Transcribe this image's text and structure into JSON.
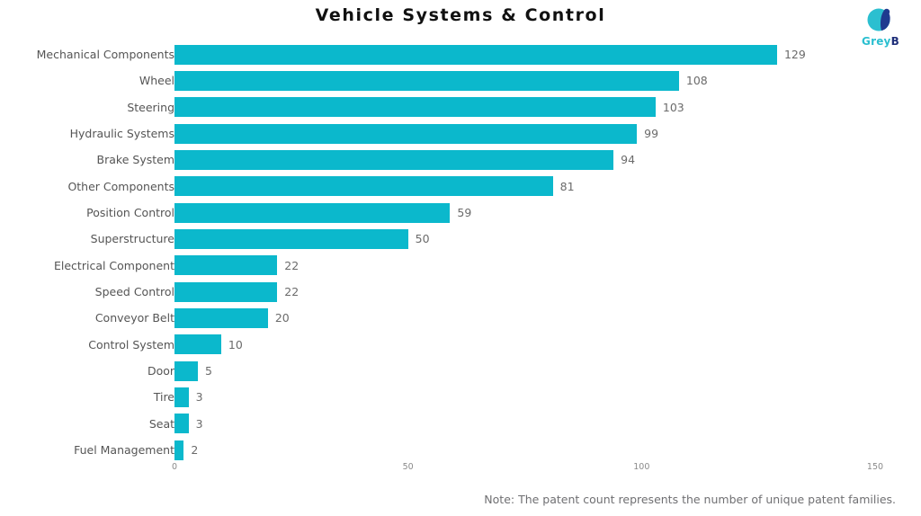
{
  "header": {
    "title": "Vehicle Systems & Control"
  },
  "logo": {
    "name": "greyb-logo",
    "text_main": "Grey",
    "text_accent": "B",
    "mark_color": "#2bbfd0",
    "mark_accent_color": "#1f3b8f",
    "text_color": "#2bbfd0"
  },
  "footnote": {
    "text": "Note: The patent count represents the number of unique patent families."
  },
  "chart_data": {
    "type": "bar",
    "orientation": "horizontal",
    "title": "Vehicle Systems & Control",
    "xlabel": "",
    "ylabel": "",
    "xlim": [
      0,
      150
    ],
    "xticks": [
      0,
      50,
      100,
      150
    ],
    "xtick_labels": [
      "0",
      "50",
      "100",
      "150"
    ],
    "grid": false,
    "legend": false,
    "bar_color": "#0bb8cc",
    "value_labels": true,
    "categories": [
      "Mechanical Components",
      "Wheel",
      "Steering",
      "Hydraulic Systems",
      "Brake System",
      "Other Components",
      "Position Control",
      "Superstructure",
      "Electrical Component",
      "Speed Control",
      "Conveyor Belt",
      "Control System",
      "Door",
      "Tire",
      "Seat",
      "Fuel Management"
    ],
    "values": [
      129,
      108,
      103,
      99,
      94,
      81,
      59,
      50,
      22,
      22,
      20,
      10,
      5,
      3,
      3,
      2
    ],
    "value_label_texts": [
      "129",
      "108",
      "103",
      "99",
      "94",
      "81",
      "59",
      "50",
      "22",
      "22",
      "20",
      "10",
      "5",
      "3",
      "3",
      "2"
    ]
  }
}
